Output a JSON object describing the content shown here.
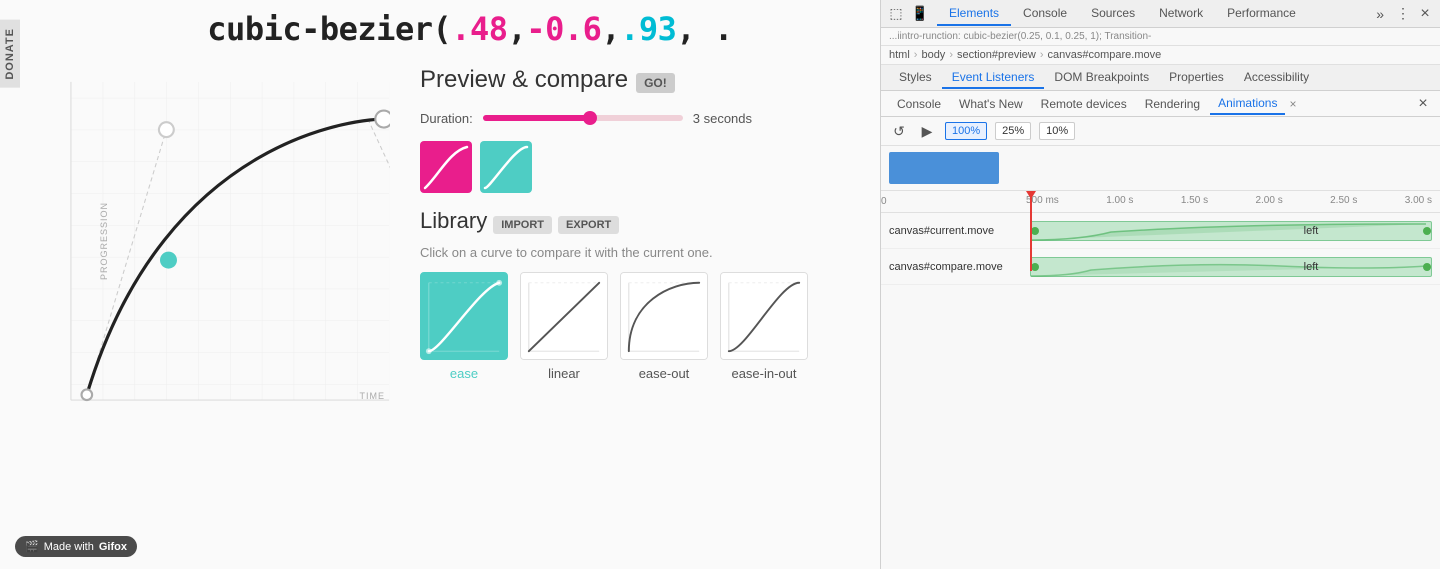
{
  "formula": {
    "prefix": "cubic-bezier(",
    "p1": ".48",
    "p2": "-0.6",
    "p3": ".93",
    "p4": ".",
    "suffix": "",
    "full": "cubic-bezier(.48,-0.6,.93,."
  },
  "donate": {
    "label": "DONATE"
  },
  "labels": {
    "progression": "PROGRESSION",
    "time": "TIME"
  },
  "preview": {
    "title": "Preview & compare",
    "go_button": "GO!",
    "duration_label": "Duration:",
    "duration_value": "3 seconds"
  },
  "library": {
    "title": "Library",
    "import_label": "IMPORT",
    "export_label": "EXPORT",
    "description": "Click on a curve to compare it with the current one.",
    "items": [
      {
        "id": "ease",
        "label": "ease",
        "active": true
      },
      {
        "id": "linear",
        "label": "linear",
        "active": false
      },
      {
        "id": "ease-out",
        "label": "ease-out",
        "active": false
      },
      {
        "id": "ease-in-out",
        "label": "ease-in-out",
        "active": false
      }
    ]
  },
  "gifox_badge": {
    "text": "Made with ",
    "brand": "Gifox"
  },
  "devtools": {
    "top_tabs": [
      "Elements",
      "Console",
      "Sources",
      "Network",
      "Performance"
    ],
    "active_top_tab": "Elements",
    "breadcrumb": [
      "html",
      "body",
      "section#preview",
      "canvas#compare.move"
    ],
    "source_text": "...iintro-runction: cubic-bezier(0.25, 0.1, 0.25, 1);  Transition-",
    "styles_tabs": [
      "Styles",
      "Event Listeners",
      "DOM Breakpoints",
      "Properties",
      "Accessibility"
    ],
    "active_styles_tab": "Event Listeners",
    "console_tabs": [
      "Console",
      "What's New",
      "Remote devices",
      "Rendering",
      "Animations"
    ],
    "active_console_tab": "Animations",
    "anim_toolbar": {
      "speed_options": [
        "100%",
        "25%",
        "10%"
      ],
      "active_speed": "100%"
    },
    "timeline": {
      "ruler_marks": [
        "500 ms",
        "1.00 s",
        "1.50 s",
        "2.00 s",
        "2.50 s",
        "3.00 s"
      ],
      "origin": "0",
      "rows": [
        {
          "label": "canvas#current.move",
          "bar_label": "left"
        },
        {
          "label": "canvas#compare.move",
          "bar_label": "left"
        }
      ]
    }
  }
}
